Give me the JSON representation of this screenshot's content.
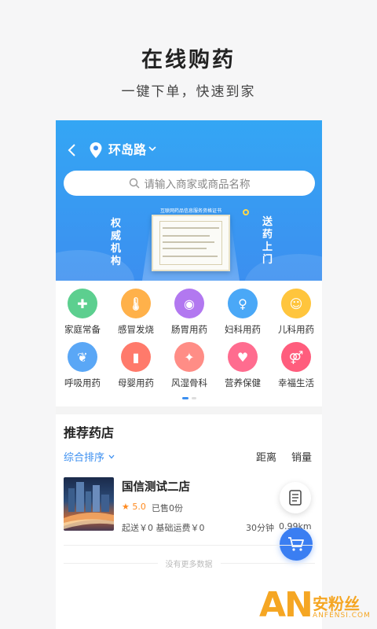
{
  "promo": {
    "title": "在线购药",
    "subtitle": "一键下单，快速到家"
  },
  "header": {
    "location": "环岛路",
    "search_placeholder": "请输入商家或商品名称"
  },
  "banner": {
    "left_text": [
      "权",
      "威",
      "机",
      "构"
    ],
    "right_text": [
      "送",
      "药",
      "上",
      "门"
    ],
    "certificate_caption": "互联网药品信息服务资格证书"
  },
  "categories": [
    {
      "label": "家庭常备",
      "icon": "medkit-icon",
      "color": "#5ccf8f"
    },
    {
      "label": "感冒发烧",
      "icon": "thermometer-icon",
      "color": "#ffb14a"
    },
    {
      "label": "肠胃用药",
      "icon": "stomach-icon",
      "color": "#b278f0"
    },
    {
      "label": "妇科用药",
      "icon": "woman-icon",
      "color": "#4aa8f7"
    },
    {
      "label": "儿科用药",
      "icon": "baby-icon",
      "color": "#ffc53d"
    },
    {
      "label": "呼吸用药",
      "icon": "lungs-icon",
      "color": "#5aa7f6"
    },
    {
      "label": "母婴用药",
      "icon": "bottle-icon",
      "color": "#ff7a6b"
    },
    {
      "label": "风湿骨科",
      "icon": "bone-icon",
      "color": "#ff8d86"
    },
    {
      "label": "营养保健",
      "icon": "heart-hand-icon",
      "color": "#ff6c8f"
    },
    {
      "label": "幸福生活",
      "icon": "couple-icon",
      "color": "#ff5d7d"
    }
  ],
  "recommend": {
    "title": "推荐药店",
    "sort_label": "综合排序",
    "distance_label": "距离",
    "sales_label": "销量"
  },
  "store": {
    "name": "国信测试二店",
    "rating": "5.0",
    "sold": "已售0份",
    "fee": "起送￥0   基础运费￥0",
    "time": "30分钟",
    "distance": "0.99km"
  },
  "footer": {
    "no_more": "没有更多数据"
  },
  "watermark": {
    "mark": "AN",
    "cn": "安粉丝",
    "en": "ANFENSI.COM"
  },
  "colors": {
    "accent": "#3c8ff0",
    "star": "#ff8a1f",
    "watermark": "#f5a623"
  }
}
